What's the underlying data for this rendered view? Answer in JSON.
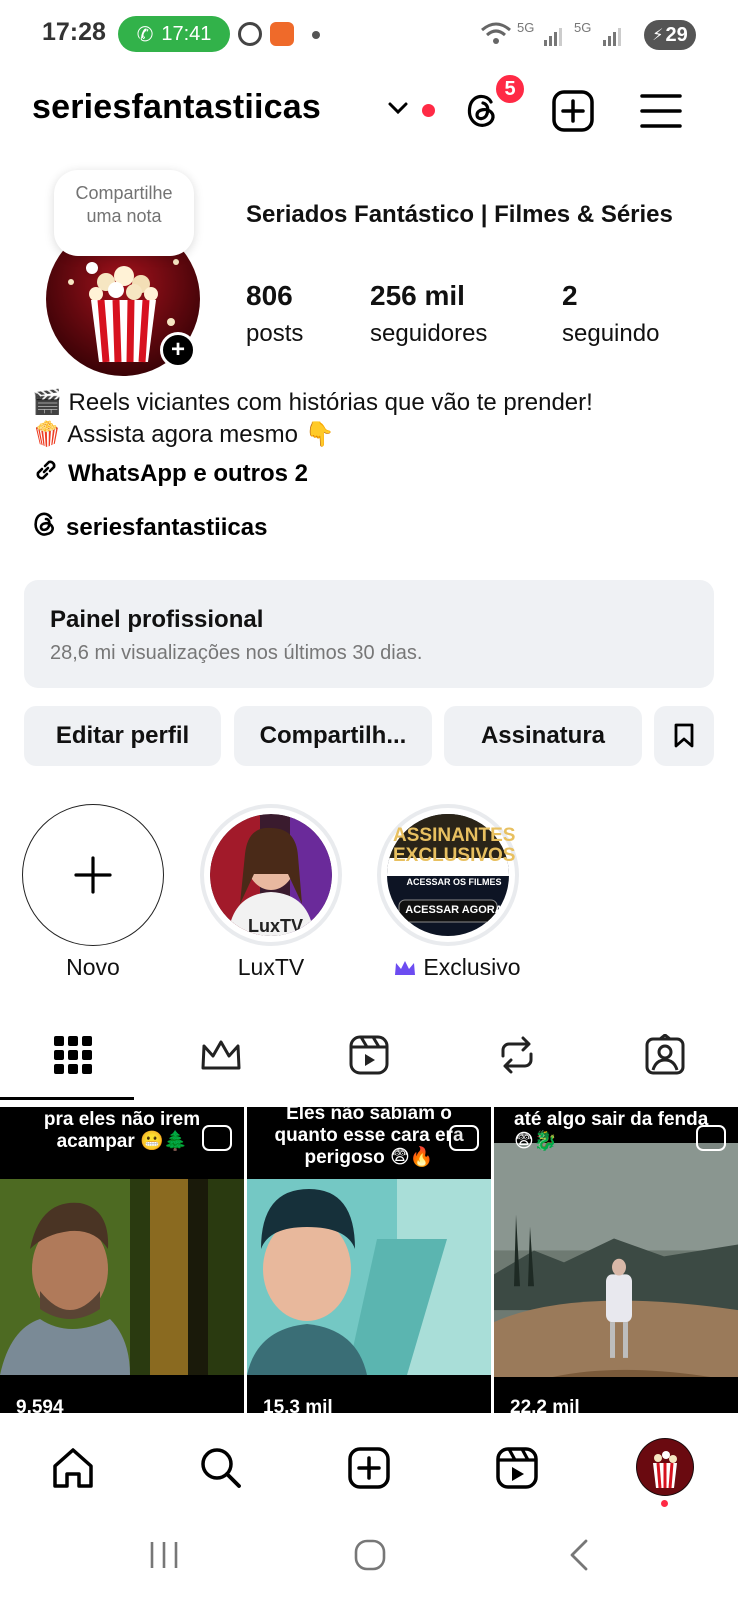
{
  "status_bar": {
    "time": "17:28",
    "call_time": "17:41",
    "battery": "29",
    "net1": "5G",
    "net2": "5G"
  },
  "header": {
    "username": "seriesfantastiicas",
    "threads_badge": "5"
  },
  "profile": {
    "note_text": "Compartilhe uma nota",
    "display_name": "Seriados Fantástico | Filmes & Séries",
    "stats": [
      {
        "value": "806",
        "label": "posts"
      },
      {
        "value": "256 mil",
        "label": "seguidores"
      },
      {
        "value": "2",
        "label": "seguindo"
      }
    ],
    "bio": [
      "🎬 Reels viciantes com histórias que vão te prender!",
      "🍿 Assista agora mesmo 👇"
    ],
    "link_text": "WhatsApp e outros 2",
    "threads_handle": "seriesfantastiicas"
  },
  "panel": {
    "title": "Painel profissional",
    "subtitle": "28,6 mi visualizações nos últimos 30 dias."
  },
  "buttons": {
    "edit": "Editar perfil",
    "share": "Compartilh...",
    "subscription": "Assinatura"
  },
  "highlights": [
    {
      "label": "Novo"
    },
    {
      "label": "LuxTV"
    },
    {
      "label": "Exclusivo"
    }
  ],
  "highlight_exclusive_text": {
    "top": "ASSINANTES EXCLUSIVOS",
    "middle": "APERTE AQUI PARA ACESSAR OS FILMES",
    "button": "ACESSAR AGORA"
  },
  "posts": [
    {
      "caption": "pra eles não irem acampar 😬🌲",
      "views": "9.594"
    },
    {
      "caption": "Eles não sabiam o quanto esse cara era perigoso 😨🔥",
      "views": "15,3 mil"
    },
    {
      "caption": "até algo sair da fenda 😨🐉",
      "views": "22,2 mil"
    }
  ],
  "colors": {
    "accent_red": "#ff2a45",
    "call_green": "#32b24a",
    "panel_bg": "#eff1f4",
    "crown_purple": "#6c4cf1"
  }
}
